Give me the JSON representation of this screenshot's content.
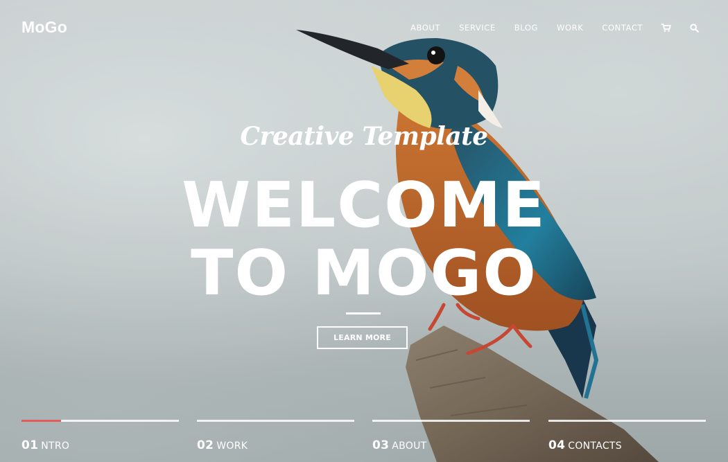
{
  "brand": "MoGo",
  "nav": {
    "items": [
      "ABOUT",
      "SERVICE",
      "BLOG",
      "WORK",
      "CONTACT"
    ],
    "cart_icon": "cart-icon",
    "search_icon": "search-icon"
  },
  "hero": {
    "tagline": "Creative Template",
    "title_line1": "WELCOME",
    "title_line2": "TO MOGO",
    "button_label": "LEARN MORE"
  },
  "slides": [
    {
      "number": "01",
      "label": "NTRO",
      "progress": 0.25
    },
    {
      "number": "02",
      "label": "WORK",
      "progress": 0
    },
    {
      "number": "03",
      "label": "ABOUT",
      "progress": 0
    },
    {
      "number": "04",
      "label": "CONTACTS",
      "progress": 0
    }
  ],
  "colors": {
    "accent": "#e35b5b",
    "text": "#ffffff"
  }
}
